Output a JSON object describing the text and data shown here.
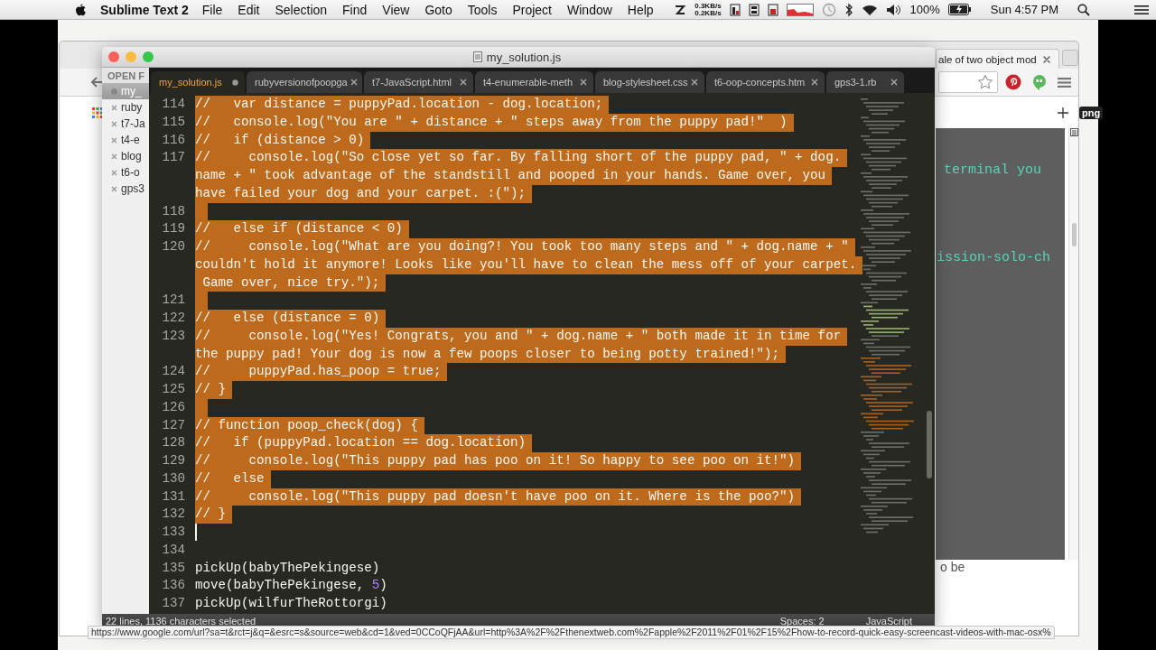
{
  "menu_bar": {
    "app_name": "Sublime Text 2",
    "menus": [
      "File",
      "Edit",
      "Selection",
      "Find",
      "View",
      "Goto",
      "Tools",
      "Project",
      "Window",
      "Help"
    ],
    "network_up": "0.3KB/s",
    "network_down": "0.2KB/s",
    "battery_percent": "100%",
    "clock": "Sun 4:57 PM"
  },
  "browser": {
    "tab_title": "ale of two object mod",
    "terminal_lines": [
      "terminal you",
      "ission-solo-ch"
    ],
    "page_text": "o be"
  },
  "desktop": {
    "file_label": "png"
  },
  "editor": {
    "title": "my_solution.js",
    "sidebar": {
      "header": "OPEN F",
      "files": [
        {
          "name": "my_",
          "selected": true,
          "dirty": true
        },
        {
          "name": "ruby",
          "selected": false,
          "dirty": false
        },
        {
          "name": "t7-Ja",
          "selected": false,
          "dirty": false
        },
        {
          "name": "t4-e",
          "selected": false,
          "dirty": false
        },
        {
          "name": "blog",
          "selected": false,
          "dirty": false
        },
        {
          "name": "t6-o",
          "selected": false,
          "dirty": false
        },
        {
          "name": "gps3",
          "selected": false,
          "dirty": false
        }
      ]
    },
    "tabs": [
      {
        "label": "my_solution.js",
        "selected": true,
        "dirty": true
      },
      {
        "label": "rubyversionofpoopga",
        "selected": false,
        "dirty": false
      },
      {
        "label": "t7-JavaScript.html",
        "selected": false,
        "dirty": false
      },
      {
        "label": "t4-enumerable-meth",
        "selected": false,
        "dirty": false
      },
      {
        "label": "blog-stylesheet.css",
        "selected": false,
        "dirty": false
      },
      {
        "label": "t6-oop-concepts.htm",
        "selected": false,
        "dirty": false
      },
      {
        "label": "gps3-1.rb",
        "selected": false,
        "dirty": false
      }
    ],
    "lines": [
      {
        "number": "114",
        "selected": true,
        "cursor": false,
        "rows": [
          "//   var distance = puppyPad.location - dog.location;"
        ]
      },
      {
        "number": "115",
        "selected": true,
        "cursor": false,
        "rows": [
          "//   console.log(\"You are \" + distance + \" steps away from the puppy pad!\"  )"
        ]
      },
      {
        "number": "116",
        "selected": true,
        "cursor": false,
        "rows": [
          "//   if (distance > 0)"
        ]
      },
      {
        "number": "117",
        "selected": true,
        "cursor": false,
        "rows": [
          "//     console.log(\"So close yet so far. By falling short of the puppy pad, \" + dog.",
          "name + \" took advantage of the standstill and pooped in your hands. Game over, you",
          "have failed your dog and your carpet. :(\");"
        ]
      },
      {
        "number": "118",
        "selected": true,
        "cursor": false
      },
      {
        "number": "119",
        "selected": true,
        "cursor": false,
        "rows": [
          "//   else if (distance < 0)"
        ]
      },
      {
        "number": "120",
        "selected": true,
        "cursor": false,
        "rows": [
          "//     console.log(\"What are you doing?! You took too many steps and \" + dog.name + \"",
          "couldn't hold it anymore! Looks like you'll have to clean the mess off of your carpet.",
          " Game over, nice try.\");"
        ]
      },
      {
        "number": "121",
        "selected": true,
        "cursor": false
      },
      {
        "number": "122",
        "selected": true,
        "cursor": false,
        "rows": [
          "//   else (distance = 0)"
        ]
      },
      {
        "number": "123",
        "selected": true,
        "cursor": false,
        "rows": [
          "//     console.log(\"Yes! Congrats, you and \" + dog.name + \" both made it in time for",
          "the puppy pad! Your dog is now a few poops closer to being potty trained!\");"
        ]
      },
      {
        "number": "124",
        "selected": true,
        "cursor": false,
        "rows": [
          "//     puppyPad.has_poop = true;"
        ]
      },
      {
        "number": "125",
        "selected": true,
        "cursor": false,
        "rows": [
          "// }"
        ]
      },
      {
        "number": "126",
        "selected": true,
        "cursor": false
      },
      {
        "number": "127",
        "selected": true,
        "cursor": false,
        "rows": [
          "// function poop_check(dog) {"
        ]
      },
      {
        "number": "128",
        "selected": true,
        "cursor": false,
        "rows": [
          "//   if (puppyPad.location == dog.location)"
        ]
      },
      {
        "number": "129",
        "selected": true,
        "cursor": false,
        "rows": [
          "//     console.log(\"This puppy pad has poo on it! So happy to see poo on it!\")"
        ]
      },
      {
        "number": "130",
        "selected": true,
        "cursor": false,
        "rows": [
          "//   else"
        ]
      },
      {
        "number": "131",
        "selected": true,
        "cursor": false,
        "rows": [
          "//     console.log(\"This puppy pad doesn't have poo on it. Where is the poo?\")"
        ]
      },
      {
        "number": "132",
        "selected": true,
        "cursor": false,
        "rows": [
          "// }"
        ]
      },
      {
        "number": "133",
        "selected": false,
        "cursor": true
      },
      {
        "number": "134",
        "selected": false,
        "cursor": false
      },
      {
        "number": "135",
        "selected": false,
        "cursor": false,
        "rows": [
          "pickUp(babyThePekingese)"
        ]
      },
      {
        "number": "136",
        "selected": false,
        "cursor": false,
        "tokens": [
          {
            "text": "move(babyThePekingese, ",
            "kind": "plain"
          },
          {
            "text": "5",
            "kind": "number"
          },
          {
            "text": ")",
            "kind": "plain"
          }
        ]
      },
      {
        "number": "137",
        "selected": false,
        "cursor": false,
        "rows": [
          "pickUp(wilfurTheRottorgi)"
        ]
      }
    ],
    "status": {
      "selection": "22 lines, 1136 characters selected",
      "indentation": "Spaces: 2",
      "syntax": "JavaScript"
    }
  },
  "link_preview": "https://www.google.com/url?sa=t&rct=j&q=&esrc=s&source=web&cd=1&ved=0CCoQFjAA&url=http%3A%2F%2Fthenextweb.com%2Fapple%2F2011%2F01%2F15%2Fhow-to-record-quick-easy-screencast-videos-with-mac-osx%"
}
